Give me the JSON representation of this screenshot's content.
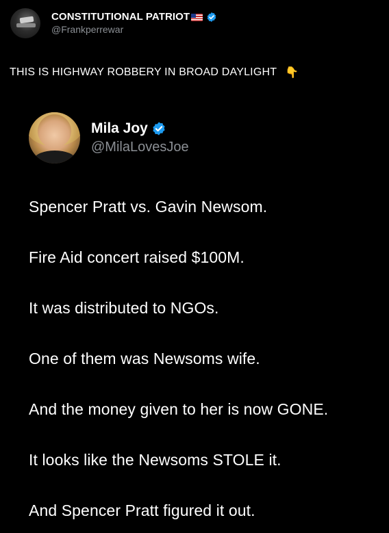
{
  "post": {
    "author_name": "CONSTITUTIONAL PATRIOT",
    "author_flag_icon": "us-flag-icon",
    "verified_icon": "verified-badge-icon",
    "handle": "@Frankperrewar",
    "text": "THIS IS HIGHWAY ROBBERY IN BROAD DAYLIGHT",
    "text_emoji": "👇"
  },
  "quoted_post": {
    "author_name": "Mila Joy",
    "verified_icon": "verified-badge-icon",
    "handle": "@MilaLovesJoe",
    "lines": [
      "Spencer Pratt vs. Gavin Newsom.",
      "Fire Aid concert raised $100M.",
      "It was distributed to NGOs.",
      "One of them was Newsoms wife.",
      "And the money given to her is now GONE.",
      "It looks like the Newsoms STOLE it.",
      "And Spencer Pratt figured it out."
    ]
  },
  "colors": {
    "background": "#000000",
    "text": "#ffffff",
    "muted": "#8b8f94",
    "verified": "#1d9bf0"
  }
}
